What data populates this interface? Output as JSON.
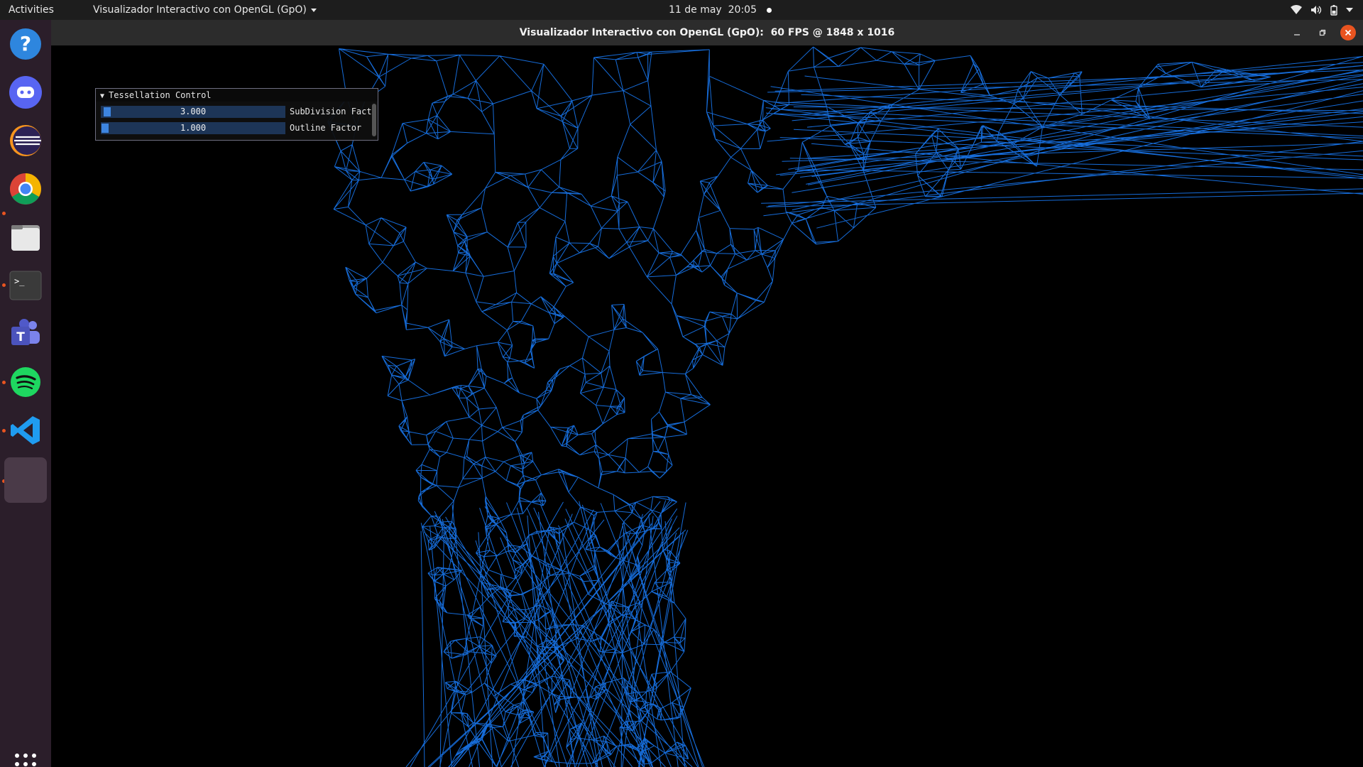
{
  "topbar": {
    "activities": "Activities",
    "app_menu": "Visualizador Interactivo con OpenGL (GpO)",
    "date": "11 de may",
    "time": "20:05"
  },
  "dock": {
    "apps": [
      {
        "name": "help",
        "icon": "help-icon",
        "running": false
      },
      {
        "name": "discord",
        "icon": "discord-icon",
        "running": false
      },
      {
        "name": "eclipse",
        "icon": "eclipse-icon",
        "running": false
      },
      {
        "name": "chrome",
        "icon": "chrome-icon",
        "running": true
      },
      {
        "name": "files",
        "icon": "files-icon",
        "running": false
      },
      {
        "name": "terminal",
        "icon": "terminal-icon",
        "running": true
      },
      {
        "name": "teams",
        "icon": "teams-icon",
        "running": false
      },
      {
        "name": "spotify",
        "icon": "spotify-icon",
        "running": true
      },
      {
        "name": "vscode",
        "icon": "vscode-icon",
        "running": true
      },
      {
        "name": "opengl-app",
        "icon": "app-window-icon",
        "running": true
      }
    ]
  },
  "window": {
    "title": "Visualizador Interactivo con OpenGL (GpO):",
    "fps": "60 FPS @ 1848 x 1016"
  },
  "imgui": {
    "title": "Tessellation Control",
    "sliders": [
      {
        "label": "SubDivision Fact",
        "value_text": "3.000",
        "value": 3.0
      },
      {
        "label": "Outline Factor",
        "value_text": "1.000",
        "value": 1.0
      }
    ]
  },
  "colors": {
    "mesh_line": "#1a7fff",
    "accent": "#e95420",
    "panel_slider": "#1d3557",
    "panel_grab": "#3d85e0"
  }
}
